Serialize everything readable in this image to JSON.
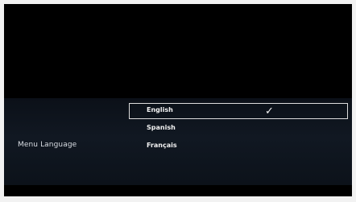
{
  "settings": {
    "menu_language_label": "Menu Language",
    "selected_icon": "check-icon",
    "options": [
      {
        "label": "English",
        "selected": true
      },
      {
        "label": "Spanish",
        "selected": false
      },
      {
        "label": "Français",
        "selected": false
      }
    ]
  }
}
